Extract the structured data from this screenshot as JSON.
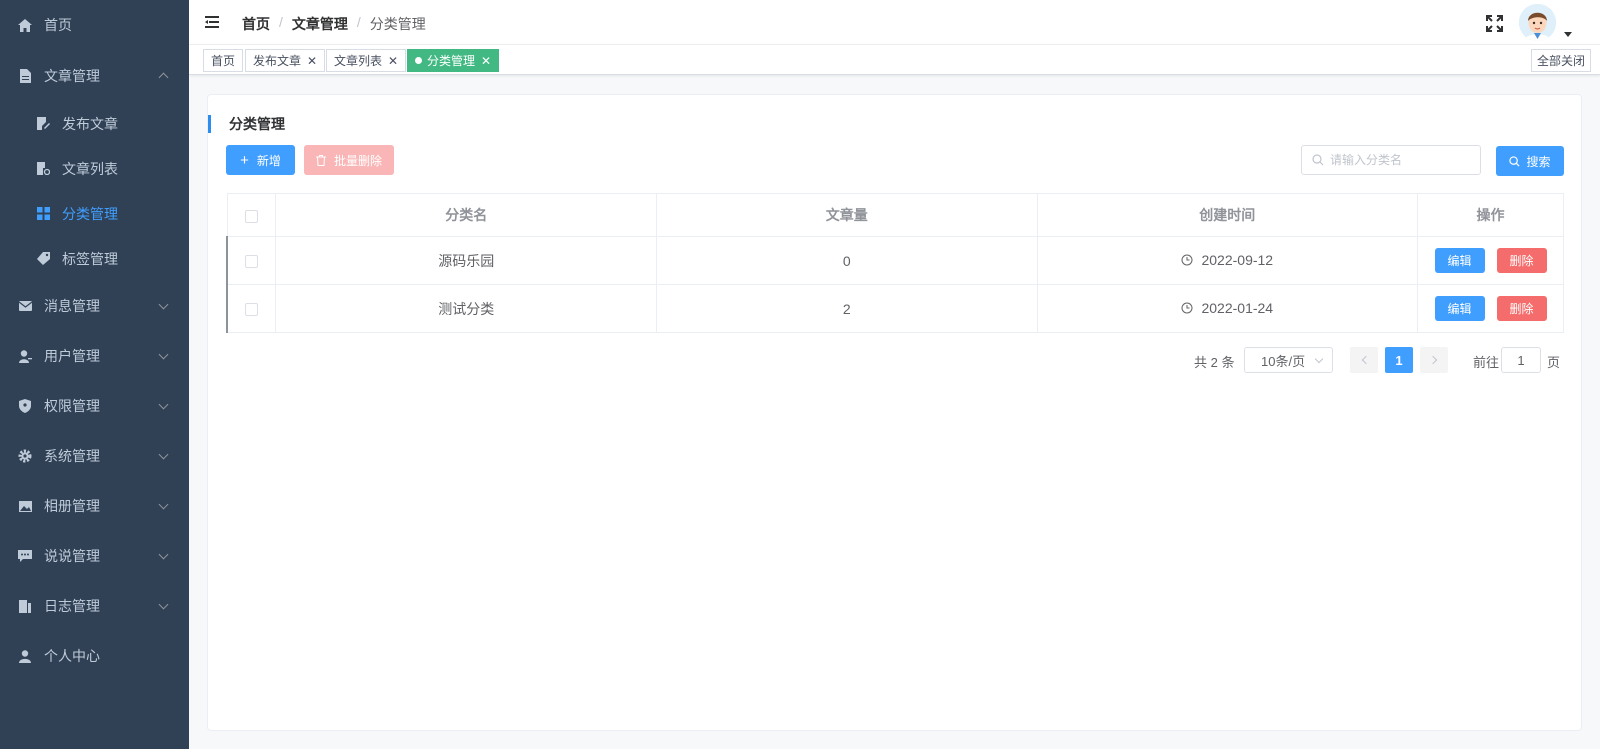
{
  "sidebar": {
    "items": [
      {
        "label": "首页",
        "icon": "home-icon"
      },
      {
        "label": "文章管理",
        "icon": "document-icon",
        "expanded": true
      },
      {
        "label": "消息管理",
        "icon": "mail-icon"
      },
      {
        "label": "用户管理",
        "icon": "user-manage-icon"
      },
      {
        "label": "权限管理",
        "icon": "shield-icon"
      },
      {
        "label": "系统管理",
        "icon": "gear-icon"
      },
      {
        "label": "相册管理",
        "icon": "image-icon"
      },
      {
        "label": "说说管理",
        "icon": "chat-icon"
      },
      {
        "label": "日志管理",
        "icon": "log-icon"
      },
      {
        "label": "个人中心",
        "icon": "person-icon"
      }
    ],
    "subitems": [
      {
        "label": "发布文章",
        "icon": "edit-icon"
      },
      {
        "label": "文章列表",
        "icon": "list-icon"
      },
      {
        "label": "分类管理",
        "icon": "grid-icon",
        "active": true
      },
      {
        "label": "标签管理",
        "icon": "tag-icon"
      }
    ],
    "accent_color": "#409eff",
    "bg_color": "#304156"
  },
  "header": {
    "breadcrumb": [
      "首页",
      "文章管理",
      "分类管理"
    ],
    "separator": "/"
  },
  "tags": {
    "items": [
      {
        "label": "首页",
        "closable": false
      },
      {
        "label": "发布文章",
        "closable": true
      },
      {
        "label": "文章列表",
        "closable": true
      },
      {
        "label": "分类管理",
        "closable": true,
        "active": true
      }
    ],
    "close_glyph": "✕",
    "close_all": "全部关闭",
    "active_color": "#42b983"
  },
  "main": {
    "title": "分类管理",
    "add_button": "新增",
    "batch_delete_button": "批量删除",
    "search_placeholder": "请输入分类名",
    "search_button": "搜索",
    "table": {
      "columns": [
        "分类名",
        "文章量",
        "创建时间",
        "操作"
      ],
      "rows": [
        {
          "name": "源码乐园",
          "count": "0",
          "created": "2022-09-12"
        },
        {
          "name": "测试分类",
          "count": "2",
          "created": "2022-01-24"
        }
      ],
      "edit_label": "编辑",
      "delete_label": "删除"
    },
    "pagination": {
      "total": "共 2 条",
      "page_size": "10条/页",
      "current_page": "1",
      "goto_label": "前往",
      "goto_value": "1",
      "page_unit": "页"
    }
  }
}
